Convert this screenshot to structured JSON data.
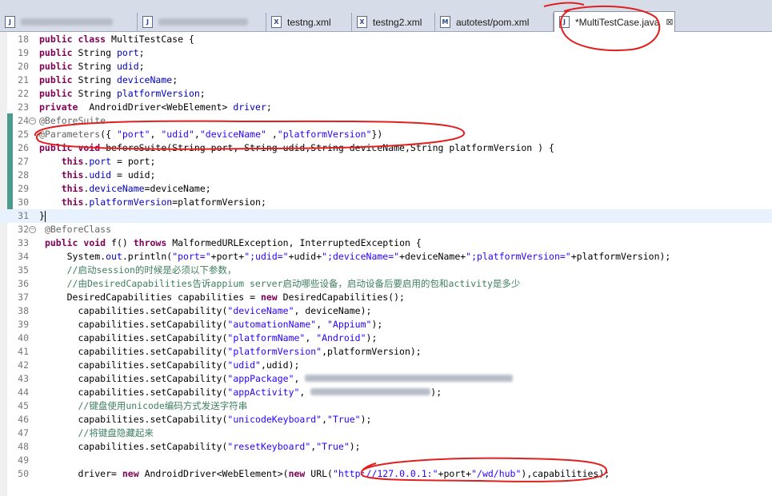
{
  "tabs": [
    {
      "label": "",
      "icon": "java-file-icon",
      "blurred": true
    },
    {
      "label": "",
      "icon": "java-file-icon",
      "blurred": true
    },
    {
      "label": "testng.xml",
      "icon": "xml-file-icon"
    },
    {
      "label": "testng2.xml",
      "icon": "xml-file-icon"
    },
    {
      "label": "autotest/pom.xml",
      "icon": "maven-file-icon"
    },
    {
      "label": "*MultiTestCase.java",
      "icon": "java-file-icon",
      "active": true,
      "close": "⊠"
    }
  ],
  "colors": {
    "keyword": "#7f0055",
    "field": "#0000c0",
    "string": "#2a00ff",
    "comment": "#3f7f5f",
    "annotation": "#646464",
    "marker_red": "#e11f1f",
    "change_bar": "#4f9a8f"
  },
  "lines": [
    {
      "n": "18",
      "tokens": [
        [
          "kw",
          "public class "
        ],
        [
          "t",
          "MultiTestCase {"
        ]
      ]
    },
    {
      "n": "19",
      "tokens": [
        [
          "kw",
          "public "
        ],
        [
          "t",
          "String "
        ],
        [
          "fld",
          "port"
        ],
        [
          "t",
          ";"
        ]
      ]
    },
    {
      "n": "20",
      "tokens": [
        [
          "kw",
          "public "
        ],
        [
          "t",
          "String "
        ],
        [
          "fld",
          "udid"
        ],
        [
          "t",
          ";"
        ]
      ]
    },
    {
      "n": "21",
      "tokens": [
        [
          "kw",
          "public "
        ],
        [
          "t",
          "String "
        ],
        [
          "fld",
          "deviceName"
        ],
        [
          "t",
          ";"
        ]
      ]
    },
    {
      "n": "22",
      "tokens": [
        [
          "kw",
          "public "
        ],
        [
          "t",
          "String "
        ],
        [
          "fld",
          "platformVersion"
        ],
        [
          "t",
          ";"
        ]
      ]
    },
    {
      "n": "23",
      "tokens": [
        [
          "kw",
          "private  "
        ],
        [
          "t",
          "AndroidDriver<WebElement> "
        ],
        [
          "fld",
          "driver"
        ],
        [
          "t",
          ";"
        ]
      ]
    },
    {
      "n": "24",
      "fold": "⊖",
      "tokens": [
        [
          "ann",
          "@BeforeSuite"
        ]
      ]
    },
    {
      "n": "25",
      "tokens": [
        [
          "ann",
          "@Parameters"
        ],
        [
          "t",
          "({ "
        ],
        [
          "str",
          "\"port\""
        ],
        [
          "t",
          ", "
        ],
        [
          "str",
          "\"udid\""
        ],
        [
          "t",
          ","
        ],
        [
          "str",
          "\"deviceName\""
        ],
        [
          "t",
          " ,"
        ],
        [
          "str",
          "\"platformVersion\""
        ],
        [
          "t",
          "})"
        ]
      ]
    },
    {
      "n": "26",
      "tokens": [
        [
          "kw",
          "public void "
        ],
        [
          "t",
          "beforeSuite(String port, String udid,String deviceName,String platformVersion ) {"
        ]
      ]
    },
    {
      "n": "27",
      "tokens": [
        [
          "t",
          "    "
        ],
        [
          "kw",
          "this"
        ],
        [
          "t",
          "."
        ],
        [
          "fld",
          "port"
        ],
        [
          "t",
          " = port;"
        ]
      ]
    },
    {
      "n": "28",
      "tokens": [
        [
          "t",
          "    "
        ],
        [
          "kw",
          "this"
        ],
        [
          "t",
          "."
        ],
        [
          "fld",
          "udid"
        ],
        [
          "t",
          " = udid;"
        ]
      ]
    },
    {
      "n": "29",
      "tokens": [
        [
          "t",
          "    "
        ],
        [
          "kw",
          "this"
        ],
        [
          "t",
          "."
        ],
        [
          "fld",
          "deviceName"
        ],
        [
          "t",
          "=deviceName;"
        ]
      ]
    },
    {
      "n": "30",
      "tokens": [
        [
          "t",
          "    "
        ],
        [
          "kw",
          "this"
        ],
        [
          "t",
          "."
        ],
        [
          "fld",
          "platformVersion"
        ],
        [
          "t",
          "=platformVersion;"
        ]
      ]
    },
    {
      "n": "31",
      "cursor": true,
      "tokens": [
        [
          "t",
          "}"
        ]
      ]
    },
    {
      "n": "32",
      "fold": "⊖",
      "tokens": [
        [
          "t",
          " "
        ],
        [
          "ann",
          "@BeforeClass"
        ]
      ]
    },
    {
      "n": "33",
      "tokens": [
        [
          "t",
          " "
        ],
        [
          "kw",
          "public void "
        ],
        [
          "t",
          "f() "
        ],
        [
          "kw",
          "throws "
        ],
        [
          "t",
          "MalformedURLException, InterruptedException {"
        ]
      ]
    },
    {
      "n": "34",
      "tokens": [
        [
          "t",
          "     System."
        ],
        [
          "fld",
          "out"
        ],
        [
          "t",
          ".println("
        ],
        [
          "str",
          "\"port=\""
        ],
        [
          "t",
          "+port+"
        ],
        [
          "str",
          "\";udid=\""
        ],
        [
          "t",
          "+udid+"
        ],
        [
          "str",
          "\";deviceName=\""
        ],
        [
          "t",
          "+deviceName+"
        ],
        [
          "str",
          "\";platformVersion=\""
        ],
        [
          "t",
          "+platformVersion);"
        ]
      ]
    },
    {
      "n": "35",
      "tokens": [
        [
          "t",
          "     "
        ],
        [
          "cmt",
          "//启动session的时候是必须以下参数，"
        ]
      ]
    },
    {
      "n": "36",
      "tokens": [
        [
          "t",
          "     "
        ],
        [
          "cmt",
          "//由DesiredCapabilities告诉appium server启动哪些设备，启动设备后要启用的包和activity是多少"
        ]
      ]
    },
    {
      "n": "37",
      "tokens": [
        [
          "t",
          "     DesiredCapabilities "
        ],
        [
          "t",
          "capabilities = "
        ],
        [
          "kw",
          "new "
        ],
        [
          "t",
          "DesiredCapabilities();"
        ]
      ]
    },
    {
      "n": "38",
      "tokens": [
        [
          "t",
          "       capabilities.setCapability("
        ],
        [
          "str",
          "\"deviceName\""
        ],
        [
          "t",
          ", deviceName);"
        ]
      ]
    },
    {
      "n": "39",
      "tokens": [
        [
          "t",
          "       capabilities.setCapability("
        ],
        [
          "str",
          "\"automationName\""
        ],
        [
          "t",
          ", "
        ],
        [
          "str",
          "\"Appium\""
        ],
        [
          "t",
          ");"
        ]
      ]
    },
    {
      "n": "40",
      "tokens": [
        [
          "t",
          "       capabilities.setCapability("
        ],
        [
          "str",
          "\"platformName\""
        ],
        [
          "t",
          ", "
        ],
        [
          "str",
          "\"Android\""
        ],
        [
          "t",
          ");"
        ]
      ]
    },
    {
      "n": "41",
      "tokens": [
        [
          "t",
          "       capabilities.setCapability("
        ],
        [
          "str",
          "\"platformVersion\""
        ],
        [
          "t",
          ",platformVersion);"
        ]
      ]
    },
    {
      "n": "42",
      "tokens": [
        [
          "t",
          "       capabilities.setCapability("
        ],
        [
          "str",
          "\"udid\""
        ],
        [
          "t",
          ",udid);"
        ]
      ]
    },
    {
      "n": "43",
      "tokens": [
        [
          "t",
          "       capabilities.setCapability("
        ],
        [
          "str",
          "\"appPackage\""
        ],
        [
          "t",
          ", "
        ],
        [
          "blur",
          "260"
        ]
      ]
    },
    {
      "n": "44",
      "tokens": [
        [
          "t",
          "       capabilities.setCapability("
        ],
        [
          "str",
          "\"appActivity\""
        ],
        [
          "t",
          ", "
        ],
        [
          "blur",
          "150"
        ],
        [
          "t",
          ");"
        ]
      ]
    },
    {
      "n": "45",
      "tokens": [
        [
          "t",
          "       "
        ],
        [
          "cmt",
          "//键盘使用unicode编码方式发送字符串"
        ]
      ]
    },
    {
      "n": "46",
      "tokens": [
        [
          "t",
          "       capabilities.setCapability("
        ],
        [
          "str",
          "\"unicodeKeyboard\""
        ],
        [
          "t",
          ","
        ],
        [
          "str",
          "\"True\""
        ],
        [
          "t",
          ");"
        ]
      ]
    },
    {
      "n": "47",
      "tokens": [
        [
          "t",
          "       "
        ],
        [
          "cmt",
          "//将键盘隐藏起来"
        ]
      ]
    },
    {
      "n": "48",
      "tokens": [
        [
          "t",
          "       capabilities.setCapability("
        ],
        [
          "str",
          "\"resetKeyboard\""
        ],
        [
          "t",
          ","
        ],
        [
          "str",
          "\"True\""
        ],
        [
          "t",
          ");"
        ]
      ]
    },
    {
      "n": "49",
      "tokens": []
    },
    {
      "n": "50",
      "tokens": [
        [
          "t",
          "       driver= "
        ],
        [
          "kw",
          "new "
        ],
        [
          "t",
          "AndroidDriver<WebElement>("
        ],
        [
          "kw",
          "new "
        ],
        [
          "t",
          "URL("
        ],
        [
          "str",
          "\"http://127.0.0.1:\""
        ],
        [
          "t",
          "+port+"
        ],
        [
          "str",
          "\"/wd/hub\""
        ],
        [
          "t",
          "),capabilities);"
        ]
      ]
    }
  ]
}
